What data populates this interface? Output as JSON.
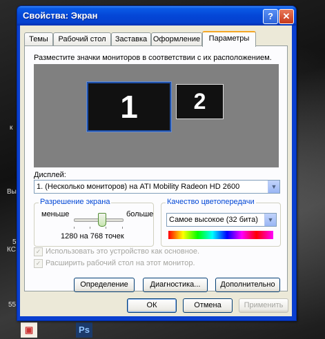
{
  "window": {
    "title": "Свойства: Экран",
    "help_label": "?",
    "close_label": "✕"
  },
  "tabs": [
    {
      "label": "Темы"
    },
    {
      "label": "Рабочий стол"
    },
    {
      "label": "Заставка"
    },
    {
      "label": "Оформление"
    },
    {
      "label": "Параметры",
      "active": true
    }
  ],
  "settings": {
    "intro": "Разместите значки мониторов в соответствии с их расположением.",
    "monitor1": "1",
    "monitor2": "2",
    "display_label": "Дисплей:",
    "display_value": "1. (Несколько мониторов) на ATI Mobility Radeon HD 2600",
    "resolution": {
      "title": "Разрешение экрана",
      "less": "меньше",
      "more": "больше",
      "value": "1280 на 768 точек",
      "slider_position": 0.65
    },
    "color": {
      "title": "Качество цветопередачи",
      "value": "Самое высокое (32 бита)"
    },
    "primary_checkbox": "Использовать это устройство как основное.",
    "extend_checkbox": "Расширить рабочий стол на этот монитор.",
    "identify_button": "Определение",
    "diagnostics_button": "Диагностика...",
    "advanced_button": "Дополнительно"
  },
  "footer": {
    "ok": "ОК",
    "cancel": "Отмена",
    "apply": "Применить"
  },
  "desktop": {
    "labels": [
      "к",
      "Вы",
      "5",
      "КС",
      "55"
    ],
    "ps_icon": "Ps"
  }
}
